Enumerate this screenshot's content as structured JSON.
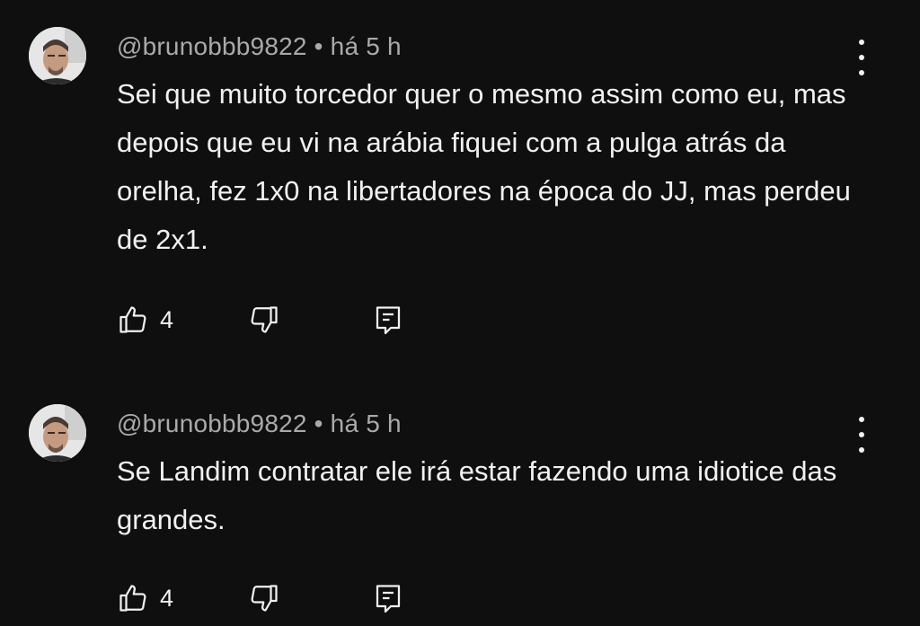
{
  "comments": [
    {
      "author": "@brunobbb9822",
      "separator": "•",
      "time": "há 5 h",
      "text": "Sei que muito torcedor quer o mesmo assim como eu, mas depois que eu vi na arábia fiquei com a pulga atrás da orelha, fez 1x0 na libertadores na época do JJ, mas perdeu de 2x1.",
      "likes": "4"
    },
    {
      "author": "@brunobbb9822",
      "separator": "•",
      "time": "há 5 h",
      "text": "Se Landim contratar ele irá estar fazendo uma idiotice das grandes.",
      "likes": "4"
    }
  ],
  "icons": {
    "like": "thumbs-up-icon",
    "dislike": "thumbs-down-icon",
    "reply": "reply-comment-icon",
    "menu": "more-vertical-icon"
  },
  "colors": {
    "background": "#0f0f0f",
    "text": "#f1f1f1",
    "meta": "#aaaaaa"
  }
}
